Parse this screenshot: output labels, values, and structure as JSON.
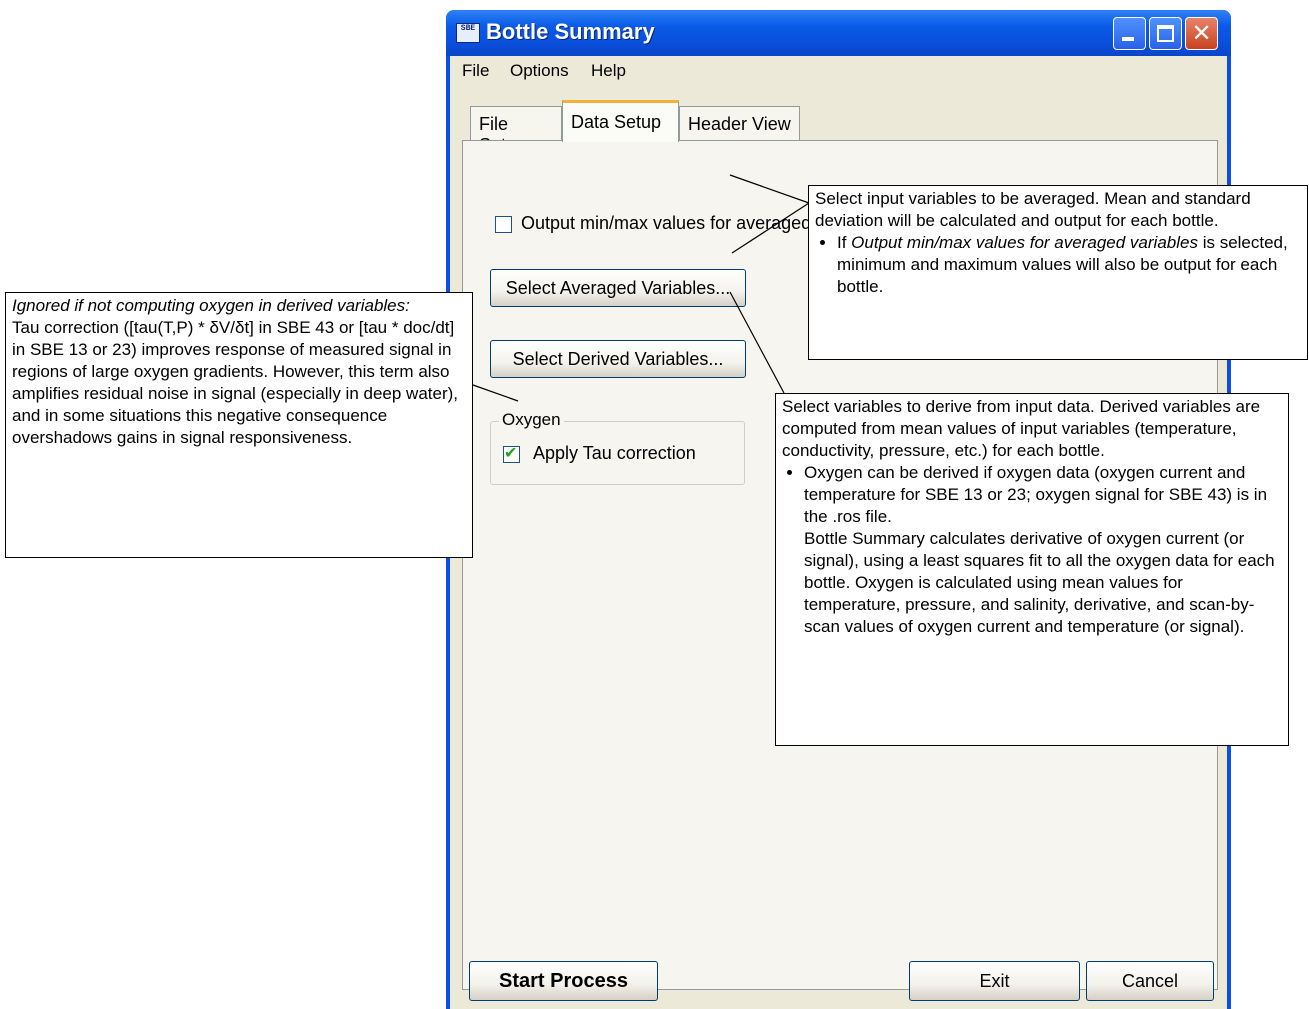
{
  "window": {
    "title": "Bottle Summary",
    "icon_label": "SBE",
    "controls": [
      "minimize-icon",
      "maximize-icon",
      "close-icon"
    ]
  },
  "menu": [
    "File",
    "Options",
    "Help"
  ],
  "tabs": [
    {
      "label": "File Setup",
      "active": false
    },
    {
      "label": "Data Setup",
      "active": true
    },
    {
      "label": "Header View",
      "active": false
    }
  ],
  "data_setup": {
    "minmax_checkbox_label": "Output min/max values for averaged variables",
    "minmax_checked": false,
    "select_averaged_button": "Select Averaged Variables...",
    "select_derived_button": "Select Derived Variables...",
    "oxygen_group_label": "Oxygen",
    "tau_checkbox_label": "Apply Tau correction",
    "tau_checked": true
  },
  "footer": {
    "start_button": "Start Process",
    "exit_button": "Exit",
    "cancel_button": "Cancel"
  },
  "callouts": {
    "averaged": {
      "text": "Select input variables to be averaged. Mean and standard deviation will be calculated and output for each bottle.",
      "bullet_prefix": "If ",
      "bullet_italic": "Output min/max values for averaged variables",
      "bullet_suffix": " is selected, minimum and maximum values will also be output for each bottle."
    },
    "derived": {
      "text": "Select variables to derive from input data. Derived variables are computed from mean values of input variables (temperature, conductivity, pressure, etc.) for each bottle.",
      "bullet": "Oxygen can be derived if oxygen data (oxygen current and temperature for SBE 13 or 23; oxygen signal for SBE 43) is in the .ros file.",
      "bullet_continuation": "Bottle Summary calculates derivative of oxygen current (or signal), using a least squares fit to all the oxygen data for each bottle. Oxygen is calculated using mean values for temperature, pressure, and salinity, derivative, and scan-by-scan values of oxygen current and temperature (or signal)."
    },
    "tau": {
      "heading": "Ignored if not computing oxygen in derived variables:",
      "text": "Tau correction ([tau(T,P) * δV/δt] in SBE 43 or [tau * doc/dt] in SBE 13 or 23) improves response of measured signal in regions of large oxygen gradients. However, this term also amplifies residual noise in signal (especially in deep water), and in some situations this negative consequence overshadows gains in signal responsiveness."
    }
  }
}
